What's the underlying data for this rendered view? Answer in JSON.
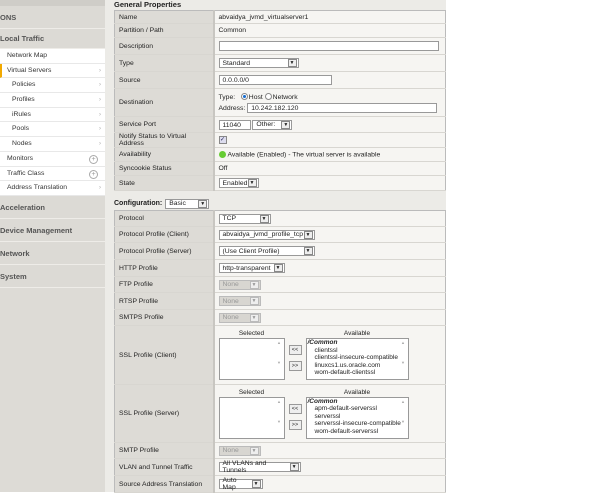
{
  "sidebar": {
    "sections_top": [
      "ONS",
      "Local Traffic"
    ],
    "items": [
      {
        "label": "Network Map"
      },
      {
        "label": "Virtual Servers"
      },
      {
        "label": "Policies"
      },
      {
        "label": "Profiles"
      },
      {
        "label": "iRules"
      },
      {
        "label": "Pools"
      },
      {
        "label": "Nodes"
      },
      {
        "label": "Monitors"
      },
      {
        "label": "Traffic Class"
      },
      {
        "label": "Address Translation"
      }
    ],
    "sections_bottom": [
      "Acceleration",
      "Device Management",
      "Network",
      "System"
    ]
  },
  "general": {
    "title": "General Properties",
    "name_label": "Name",
    "name": "abvaidya_jvmd_virtualserver1",
    "partition_label": "Partition / Path",
    "partition": "Common",
    "description_label": "Description",
    "description": "",
    "type_label": "Type",
    "type": "Standard",
    "source_label": "Source",
    "source": "0.0.0.0/0",
    "destination_label": "Destination",
    "dest_type_label": "Type:",
    "dest_host": "Host",
    "dest_network": "Network",
    "dest_address_label": "Address:",
    "dest_address": "10.242.182.120",
    "port_label": "Service Port",
    "port": "11040",
    "port_select": "Other:",
    "notify_label": "Notify Status to Virtual Address",
    "availability_label": "Availability",
    "availability": "Available (Enabled) - The virtual server is available",
    "syncookie_label": "Syncookie Status",
    "syncookie": "Off",
    "state_label": "State",
    "state": "Enabled"
  },
  "config": {
    "label": "Configuration:",
    "mode": "Basic",
    "protocol_label": "Protocol",
    "protocol": "TCP",
    "pp_client_label": "Protocol Profile (Client)",
    "pp_client": "abvaidya_jvmd_profile_tcp",
    "pp_server_label": "Protocol Profile (Server)",
    "pp_server": "(Use Client Profile)",
    "http_label": "HTTP Profile",
    "http": "http-transparent",
    "ftp_label": "FTP Profile",
    "ftp": "None",
    "rtsp_label": "RTSP Profile",
    "rtsp": "None",
    "smtps_label": "SMTPS Profile",
    "smtps": "None",
    "selected_label": "Selected",
    "available_label": "Available",
    "move_left": "<<",
    "move_right": ">>",
    "ssl_client_label": "SSL Profile (Client)",
    "ssl_client_available": [
      "/Common",
      "clientssl",
      "clientssl-insecure-compatible",
      "linuxcs1.us.oracle.com",
      "wom-default-clientssl"
    ],
    "ssl_server_label": "SSL Profile (Server)",
    "ssl_server_available": [
      "/Common",
      "apm-default-serverssl",
      "serverssl",
      "serverssl-insecure-compatible",
      "wom-default-serverssl"
    ],
    "smtp_label": "SMTP Profile",
    "smtp": "None",
    "vlan_label": "VLAN and Tunnel Traffic",
    "vlan": "All VLANs and Tunnels",
    "sat_label": "Source Address Translation",
    "sat": "Auto Map"
  }
}
